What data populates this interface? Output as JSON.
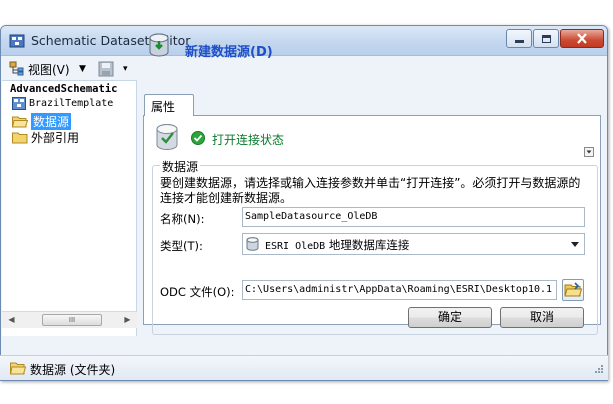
{
  "window": {
    "title": "Schematic Dataset Editor"
  },
  "toolbar": {
    "view_label": "视图(V)"
  },
  "tree": {
    "root": "AdvancedSchematic",
    "items": [
      {
        "label": "BrazilTemplate"
      },
      {
        "label": "数据源"
      },
      {
        "label": "外部引用"
      }
    ]
  },
  "header": {
    "title": "新建数据源(D)"
  },
  "tabs": [
    {
      "label": "属性"
    }
  ],
  "connection": {
    "status_text": "打开连接状态"
  },
  "form": {
    "group_label": "数据源",
    "description": "要创建数据源，请选择或输入连接参数并单击“打开连接”。必须打开与数据源的连接才能创建新数据源。",
    "name_label": "名称(N):",
    "name_value": "SampleDatasource_OleDB",
    "type_label": "类型(T):",
    "type_value_prefix": "ESRI OleDB",
    "type_value_suffix": "地理数据库连接",
    "odc_label": "ODC 文件(O):",
    "odc_value": "C:\\Users\\administr\\AppData\\Roaming\\ESRI\\Desktop10.1"
  },
  "buttons": {
    "ok": "确定",
    "cancel": "取消"
  },
  "statusbar": {
    "text": "数据源 (文件夹)"
  },
  "scrollbar": {
    "thumb_label": "III"
  }
}
